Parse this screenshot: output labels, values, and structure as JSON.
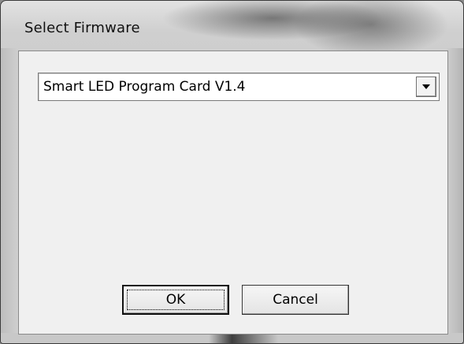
{
  "window": {
    "title": "Select Firmware"
  },
  "firmware_select": {
    "selected_value": "Smart LED Program Card V1.4"
  },
  "buttons": {
    "ok_label": "OK",
    "cancel_label": "Cancel"
  }
}
